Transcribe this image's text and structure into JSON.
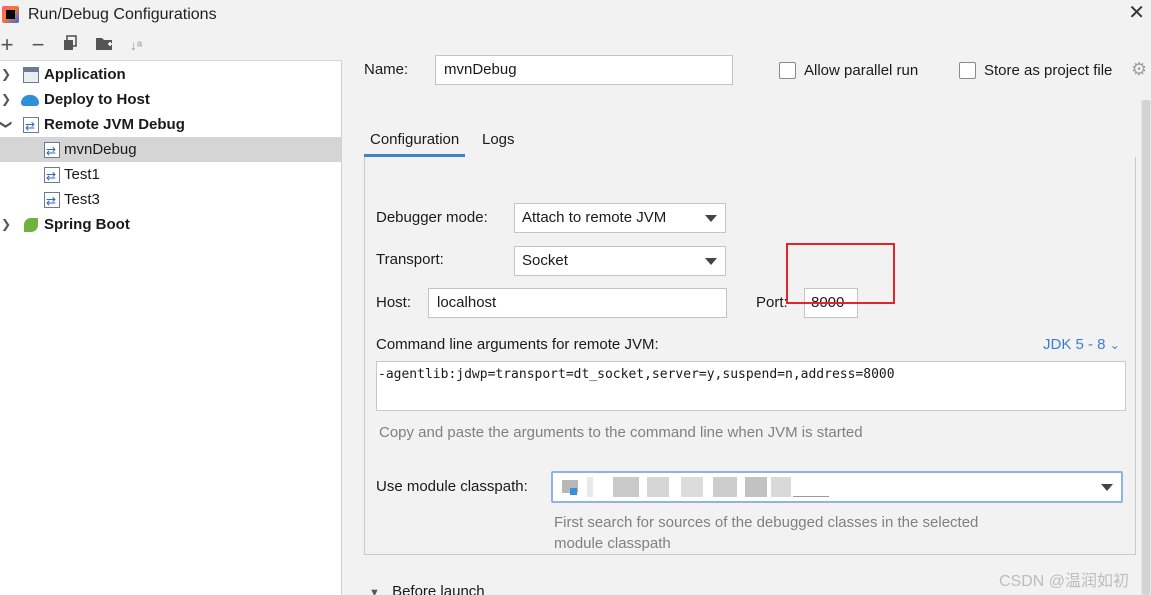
{
  "window": {
    "title": "Run/Debug Configurations",
    "close_glyph": "✕"
  },
  "toolbar": {
    "add_glyph": "+",
    "remove_glyph": "−",
    "copy_icon": "copy-icon",
    "folder_icon": "new-folder-icon",
    "sort_glyph": "↓ᵃ"
  },
  "tree": {
    "items": [
      {
        "label": "Application",
        "icon": "application-icon",
        "expanded": false,
        "bold": true
      },
      {
        "label": "Deploy to Host",
        "icon": "cloud-icon",
        "expanded": false,
        "bold": true
      },
      {
        "label": "Remote JVM Debug",
        "icon": "remote-debug-icon",
        "expanded": true,
        "bold": true
      },
      {
        "label": "mvnDebug",
        "icon": "remote-debug-icon",
        "selected": true
      },
      {
        "label": "Test1",
        "icon": "remote-debug-icon"
      },
      {
        "label": "Test3",
        "icon": "remote-debug-icon"
      },
      {
        "label": "Spring Boot",
        "icon": "spring-boot-icon",
        "expanded": false,
        "bold": true
      }
    ]
  },
  "form": {
    "name_label": "Name:",
    "name_value": "mvnDebug",
    "allow_parallel_label": "Allow parallel run",
    "store_project_label": "Store as project file",
    "tabs": [
      "Configuration",
      "Logs"
    ],
    "debugger_mode_label": "Debugger mode:",
    "debugger_mode_value": "Attach to remote JVM",
    "transport_label": "Transport:",
    "transport_value": "Socket",
    "host_label": "Host:",
    "host_value": "localhost",
    "port_label": "Port:",
    "port_value": "8000",
    "cmd_label": "Command line arguments for remote JVM:",
    "jdk_link": "JDK 5 - 8",
    "cmd_value": "-agentlib:jdwp=transport=dt_socket,server=y,suspend=n,address=8000",
    "cmd_hint": "Copy and paste the arguments to the command line when JVM is started",
    "classpath_label": "Use module classpath:",
    "classpath_hint_line1": "First search for sources of the debugged classes in the selected",
    "classpath_hint_line2": "module classpath",
    "before_launch": "Before launch"
  },
  "watermark": "CSDN @温润如初",
  "colors": {
    "accent": "#4083c9",
    "highlight_box": "#e0252d",
    "link": "#3c7fd0"
  }
}
